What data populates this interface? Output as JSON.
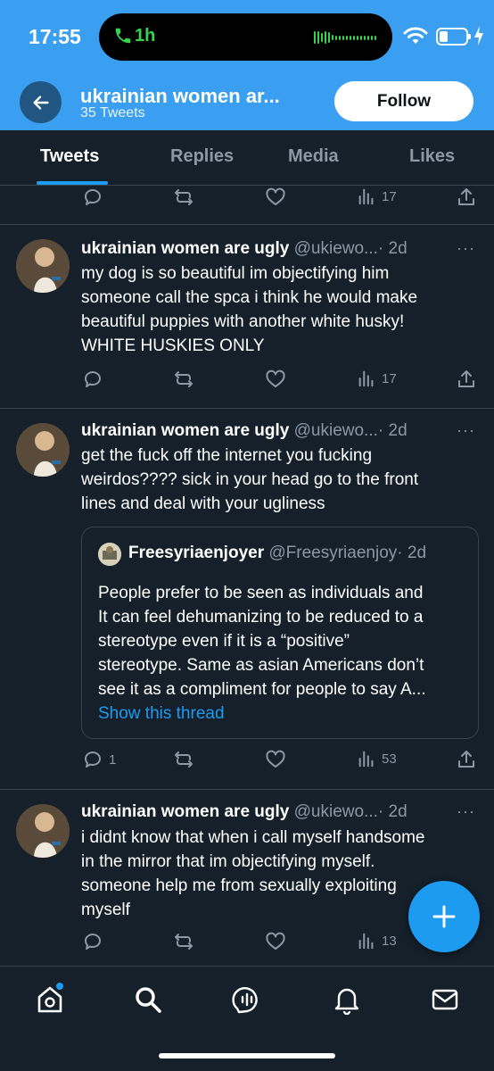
{
  "status_bar": {
    "time": "17:55",
    "call_duration": "1h"
  },
  "header": {
    "name": "ukrainian women ar...",
    "tweet_count": "35 Tweets",
    "follow_label": "Follow"
  },
  "tabs": [
    {
      "label": "Tweets",
      "active": true
    },
    {
      "label": "Replies",
      "active": false
    },
    {
      "label": "Media",
      "active": false
    },
    {
      "label": "Likes",
      "active": false
    }
  ],
  "top_partial_tweet": {
    "views": "17"
  },
  "tweets": [
    {
      "name": "ukrainian women are ugly",
      "handle": "@ukiewo...",
      "time": "· 2d",
      "more": "···",
      "lines": [
        "my dog is so beautiful im objectifying him",
        "someone call the spca i think he would make",
        "beautiful puppies with another white husky!",
        "WHITE HUSKIES ONLY"
      ],
      "replies": "",
      "views": "17"
    },
    {
      "name": "ukrainian women are ugly",
      "handle": "@ukiewo...",
      "time": "· 2d",
      "more": "···",
      "lines": [
        "get the fuck off the internet you fucking",
        "weirdos???? sick in your head go to the front",
        "lines and deal with your ugliness"
      ],
      "quote": {
        "name": "Freesyriaenjoyer",
        "handle": "@Freesyriaenjoy",
        "time": "· 2d",
        "lines": [
          "People prefer to be seen as individuals and",
          "It can feel dehumanizing to be reduced to a",
          "stereotype even if it is a “positive”",
          "stereotype. Same as asian Americans don’t",
          "see it as a compliment for people to say A..."
        ],
        "link": "Show this thread"
      },
      "replies": "1",
      "views": "53"
    },
    {
      "name": "ukrainian women are ugly",
      "handle": "@ukiewo...",
      "time": "· 2d",
      "more": "···",
      "lines": [
        "i didnt know that when i call myself handsome",
        "in the mirror that im objectifying myself.",
        "someone help me from sexually exploiting",
        "myself"
      ],
      "replies": "",
      "views": "13"
    }
  ],
  "icons": {
    "back": "arrow-left-icon",
    "reply": "speech-bubble-icon",
    "retweet": "retweet-icon",
    "like": "heart-icon",
    "views": "bar-chart-icon",
    "share": "share-icon",
    "compose": "plus-icon",
    "nav": [
      "home-icon",
      "search-icon",
      "spaces-icon",
      "bell-icon",
      "mail-icon"
    ]
  },
  "colors": {
    "header_blue": "#3a9ff0",
    "background": "#15202b",
    "accent": "#1d9bf0",
    "muted": "#8b98a5"
  }
}
